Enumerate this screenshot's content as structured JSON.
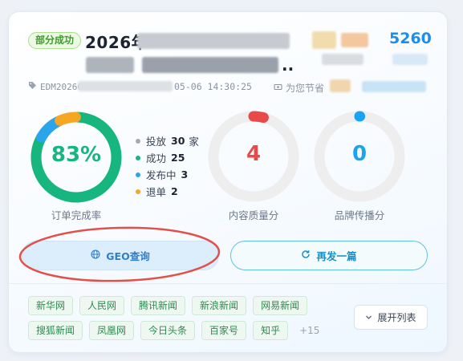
{
  "card": {
    "status_badge": "部分成功",
    "title_year": "2026年",
    "title_ellipsis": "..",
    "side_number": "5260",
    "meta": {
      "tag_id": "EDM20260",
      "time": "05-06 14:30:25",
      "save_label": "为您节省"
    }
  },
  "gauges": {
    "order_completion": {
      "value_text": "83%",
      "label": "订单完成率",
      "ring_color": "#17b67f",
      "legend": [
        {
          "label": "投放",
          "value": "30",
          "unit": "家",
          "color": "#a2a9b4"
        },
        {
          "label": "成功",
          "value": "25",
          "unit": "",
          "color": "#17b67f"
        },
        {
          "label": "发布中",
          "value": "3",
          "unit": "",
          "color": "#2aa5ec"
        },
        {
          "label": "退单",
          "value": "2",
          "unit": "",
          "color": "#f5a623"
        }
      ],
      "segments": {
        "success": 0.8333,
        "publishing": 0.1,
        "refund": 0.0667
      }
    },
    "content_quality": {
      "value_text": "4",
      "label": "内容质量分",
      "color": "#e84a4a",
      "fraction": 0.04
    },
    "brand_spread": {
      "value_text": "0",
      "label": "品牌传播分",
      "color": "#1aa3ef",
      "fraction": 0.0
    }
  },
  "buttons": {
    "geo_label": "GEO查询",
    "republish_label": "再发一篇"
  },
  "media": {
    "row1": [
      "新华网",
      "人民网",
      "腾讯新闻",
      "新浪新闻",
      "网易新闻"
    ],
    "row2": [
      "搜狐新闻",
      "凤凰网",
      "今日头条",
      "百家号",
      "知乎"
    ],
    "more": "+15",
    "expand_label": "展开列表"
  }
}
